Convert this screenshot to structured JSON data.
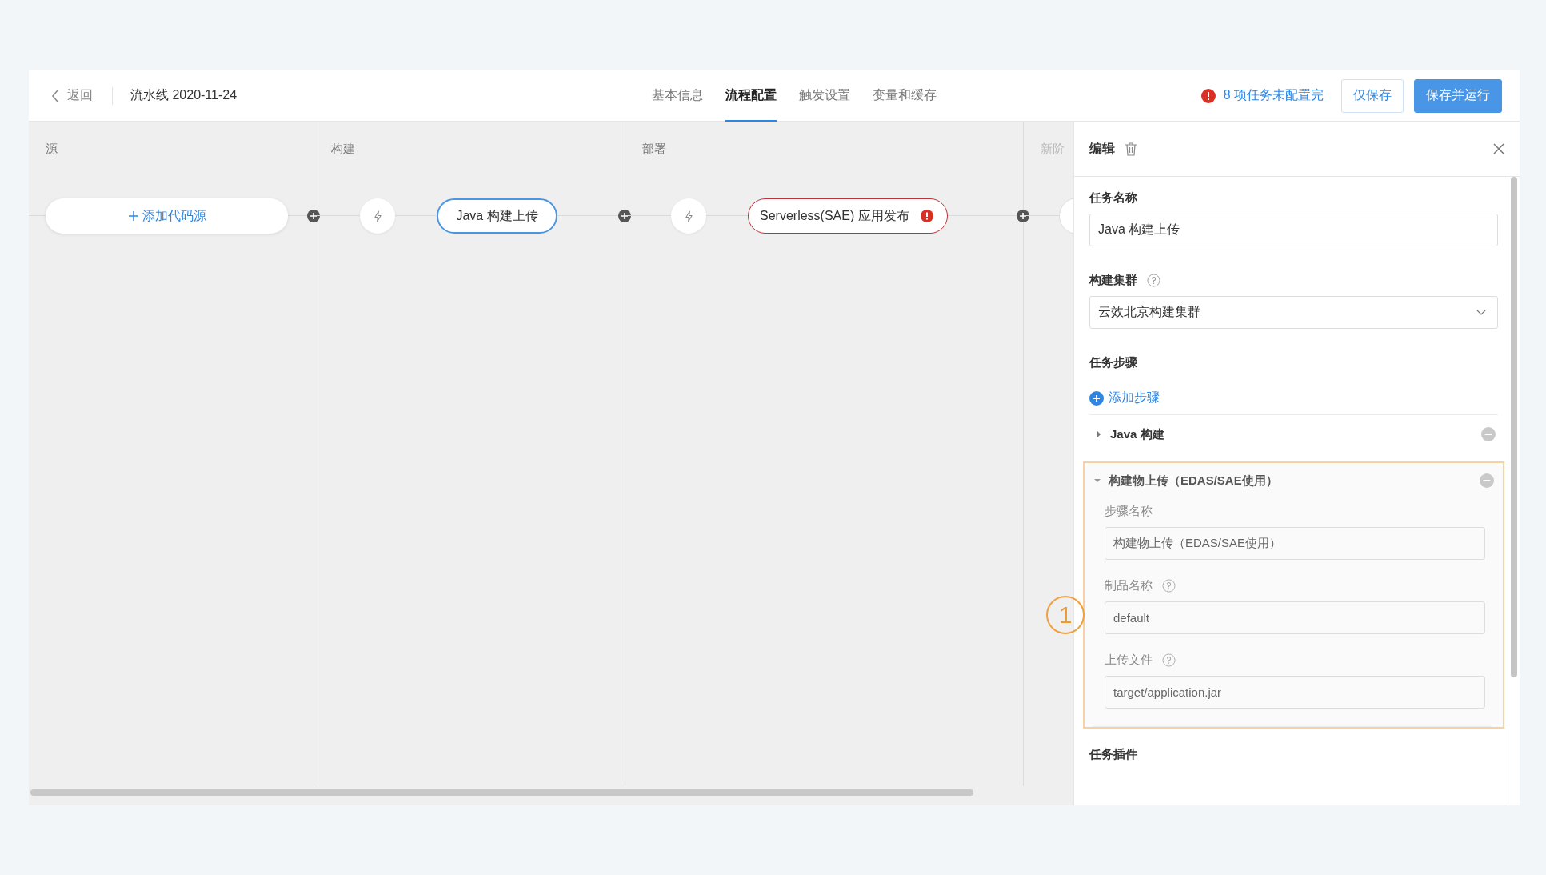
{
  "header": {
    "back": "返回",
    "title": "流水线 2020-11-24",
    "tabs": [
      {
        "label": "基本信息",
        "selected": false
      },
      {
        "label": "流程配置",
        "selected": true
      },
      {
        "label": "触发设置",
        "selected": false
      },
      {
        "label": "变量和缓存",
        "selected": false
      }
    ],
    "warning": "8 项任务未配置完",
    "buttons": [
      {
        "label": "仅保存",
        "kind": "secondary"
      },
      {
        "label": "保存并运行",
        "kind": "primary"
      }
    ]
  },
  "stages": [
    {
      "name": "源",
      "kind": "source",
      "nodes": [
        {
          "kind": "add",
          "label": "添加代码源"
        }
      ]
    },
    {
      "name": "构建",
      "kind": "stage",
      "nodes": [
        {
          "kind": "trigger"
        },
        {
          "kind": "job",
          "label": "Java 构建上传",
          "selected": true,
          "error": false
        }
      ]
    },
    {
      "name": "部署",
      "kind": "stage",
      "nodes": [
        {
          "kind": "trigger"
        },
        {
          "kind": "job",
          "label": "Serverless(SAE) 应用发布",
          "selected": false,
          "error": true
        }
      ]
    },
    {
      "name": "新阶",
      "kind": "new"
    }
  ],
  "callout": "1",
  "panel": {
    "title": "编辑",
    "task_name": {
      "label": "任务名称",
      "value": "Java 构建上传"
    },
    "cluster": {
      "label": "构建集群",
      "value": "云效北京构建集群"
    },
    "steps": {
      "label": "任务步骤",
      "add": "添加步骤",
      "items": [
        {
          "name": "Java 构建",
          "expanded": false
        },
        {
          "name": "构建物上传（EDAS/SAE使用）",
          "expanded": true,
          "fields": [
            {
              "label": "步骤名称",
              "value": "构建物上传（EDAS/SAE使用）",
              "help": false
            },
            {
              "label": "制品名称",
              "value": "default",
              "help": true
            },
            {
              "label": "上传文件",
              "value": "target/application.jar",
              "help": true
            }
          ]
        }
      ]
    },
    "plugins": {
      "label": "任务插件"
    }
  }
}
